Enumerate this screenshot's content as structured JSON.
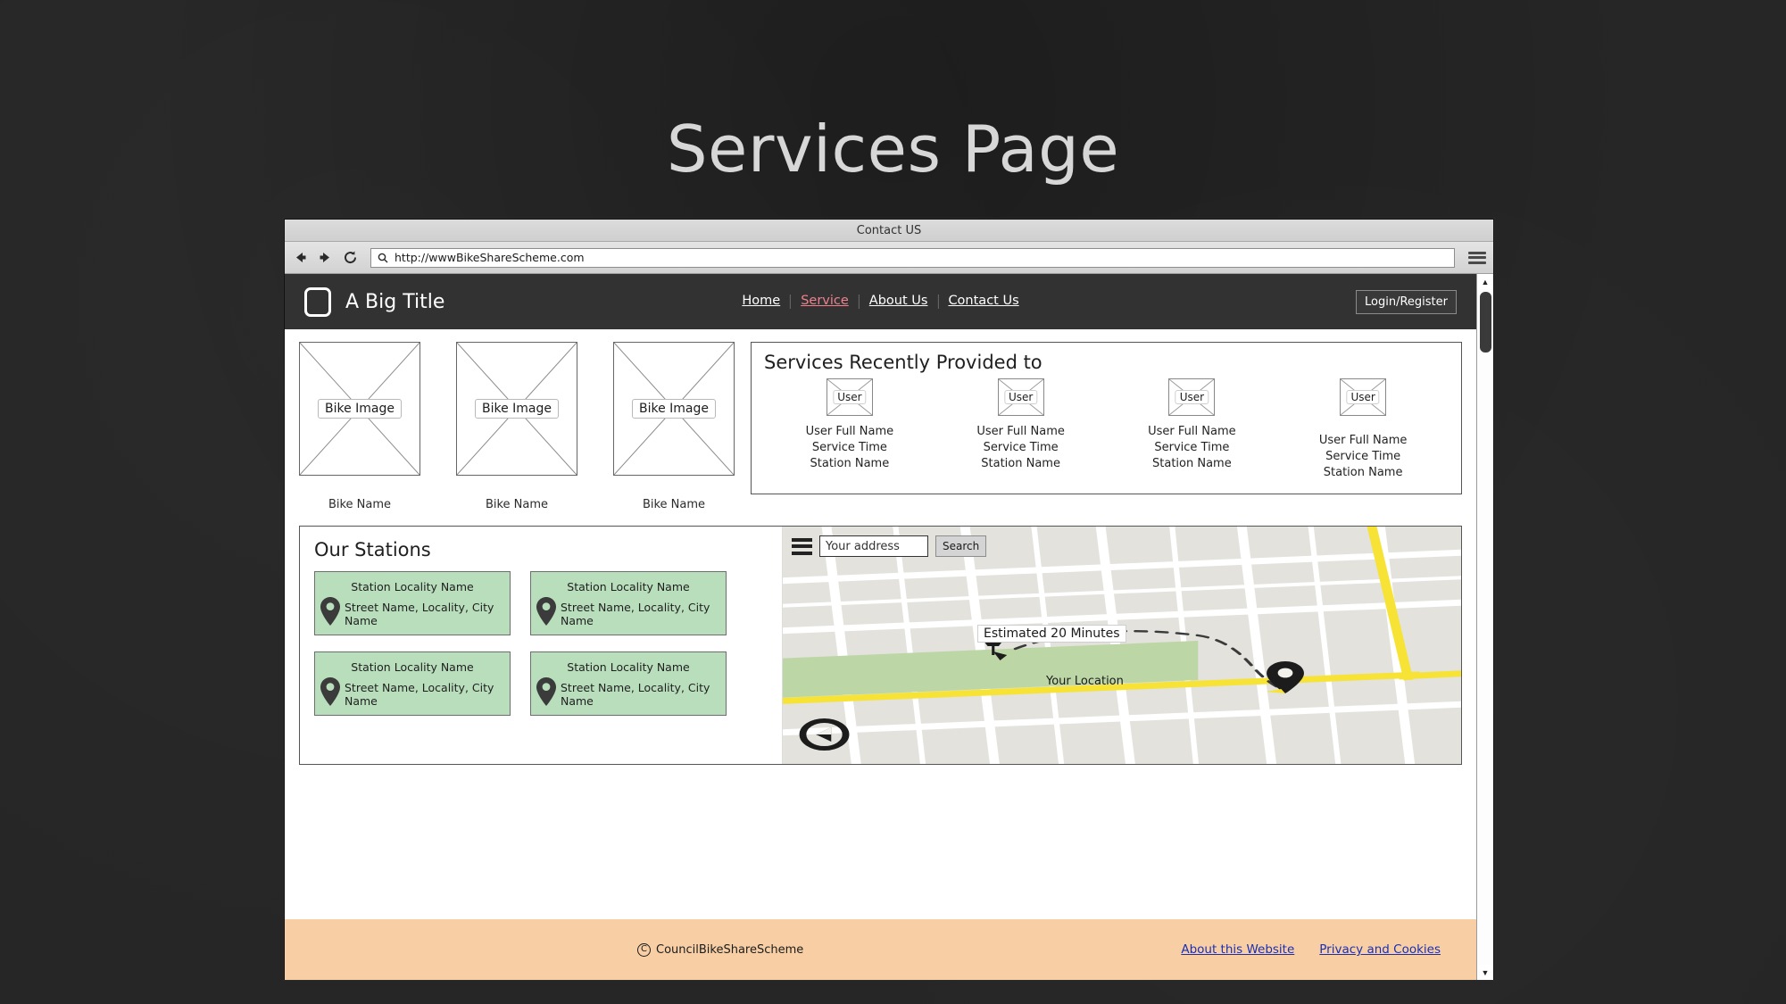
{
  "page": {
    "title": "Services Page"
  },
  "browser": {
    "tab_title": "Contact US",
    "url": "http://wwwBikeShareScheme.com",
    "back_icon": "back-arrow-icon",
    "forward_icon": "forward-arrow-icon",
    "reload_icon": "reload-icon",
    "search_icon": "search-icon",
    "menu_icon": "hamburger-menu-icon",
    "scroll_up": "▲",
    "scroll_down": "▼"
  },
  "nav": {
    "brand": "A Big Title",
    "logo_icon": "rounded-square-logo-icon",
    "items": [
      {
        "label": "Home",
        "active": false
      },
      {
        "label": "Service",
        "active": true
      },
      {
        "label": "About Us",
        "active": false
      },
      {
        "label": "Contact Us",
        "active": false
      }
    ],
    "login_label": "Login/Register",
    "active_color": "#f0808d",
    "bar_color": "#333232"
  },
  "bikes": [
    {
      "placeholder": "Bike Image",
      "name": "Bike Name"
    },
    {
      "placeholder": "Bike Image",
      "name": "Bike Name"
    },
    {
      "placeholder": "Bike Image",
      "name": "Bike Name"
    }
  ],
  "services": {
    "title": "Services Recently Provided to",
    "users": [
      {
        "avatar": "User",
        "full_name": "User Full Name",
        "service_time": "Service Time",
        "station": "Station Name"
      },
      {
        "avatar": "User",
        "full_name": "User Full Name",
        "service_time": "Service Time",
        "station": "Station Name"
      },
      {
        "avatar": "User",
        "full_name": "User Full Name",
        "service_time": "Service Time",
        "station": "Station Name"
      },
      {
        "avatar": "User",
        "full_name": "User Full Name",
        "service_time": "Service Time",
        "station": "Station Name"
      }
    ]
  },
  "stations": {
    "title": "Our Stations",
    "card_color": "#b9debc",
    "items": [
      {
        "locality": "Station Locality Name",
        "address": "Street Name, Locality, City Name",
        "pin_icon": "map-pin-icon"
      },
      {
        "locality": "Station Locality Name",
        "address": "Street Name, Locality, City Name",
        "pin_icon": "map-pin-icon"
      },
      {
        "locality": "Station Locality Name",
        "address": "Street Name, Locality, City Name",
        "pin_icon": "map-pin-icon"
      },
      {
        "locality": "Station Locality Name",
        "address": "Street Name, Locality, City Name",
        "pin_icon": "map-pin-icon"
      }
    ]
  },
  "map": {
    "menu_icon": "hamburger-menu-icon",
    "address_value": "Your address",
    "address_placeholder": "Your address",
    "search_label": "Search",
    "eta_label": "Estimated 20 Minutes",
    "your_location_label": "Your Location",
    "station_marker_icon": "pushpin-icon",
    "user_marker_icon": "map-pin-icon",
    "compass_icon": "compass-icon",
    "road_color": "#f7e335",
    "park_color": "#bcd6a6",
    "block_color": "#e3e2dd"
  },
  "footer": {
    "copyright_symbol": "C",
    "copyright_text": "CouncilBikeShareScheme",
    "links": [
      {
        "label": "About this Website"
      },
      {
        "label": "Privacy and Cookies"
      }
    ],
    "background": "#f8cfa5",
    "link_color": "#1b2fb0"
  }
}
